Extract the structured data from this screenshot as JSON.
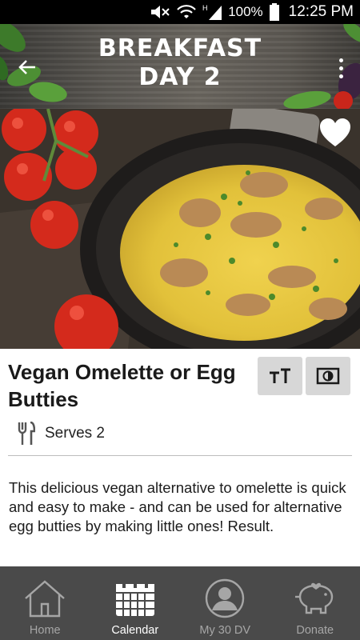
{
  "status_bar": {
    "battery": "100%",
    "time": "12:25 PM",
    "icons": [
      "mute-icon",
      "wifi-icon",
      "signal-icon",
      "battery-icon"
    ]
  },
  "header": {
    "title_line1": "BREAKFAST",
    "title_line2": "DAY 2",
    "back_icon": "arrow-left-icon",
    "menu_icon": "more-vertical-icon"
  },
  "hero": {
    "image": "vegan-omelette-in-pan-photo",
    "favorite_icon": "heart-icon"
  },
  "recipe": {
    "title": "Vegan Omelette or Egg Butties",
    "serves": "Serves 2",
    "description": "This delicious vegan alternative to omelette is quick and easy to make - and can be used for alternative egg butties by making little ones! Result."
  },
  "toolbar": {
    "text_size_icon": "text-size-icon",
    "contrast_icon": "contrast-icon"
  },
  "bottom_nav": {
    "items": [
      {
        "label": "Home",
        "icon": "home-icon",
        "active": false
      },
      {
        "label": "Calendar",
        "icon": "calendar-icon",
        "active": true
      },
      {
        "label": "My 30 DV",
        "icon": "profile-icon",
        "active": false
      },
      {
        "label": "Donate",
        "icon": "piggy-bank-icon",
        "active": false
      }
    ]
  },
  "colors": {
    "nav_background": "#4a4a4a",
    "nav_active": "#ffffff",
    "nav_inactive": "#a6a6a6",
    "tool_button": "#d7d7d7"
  }
}
